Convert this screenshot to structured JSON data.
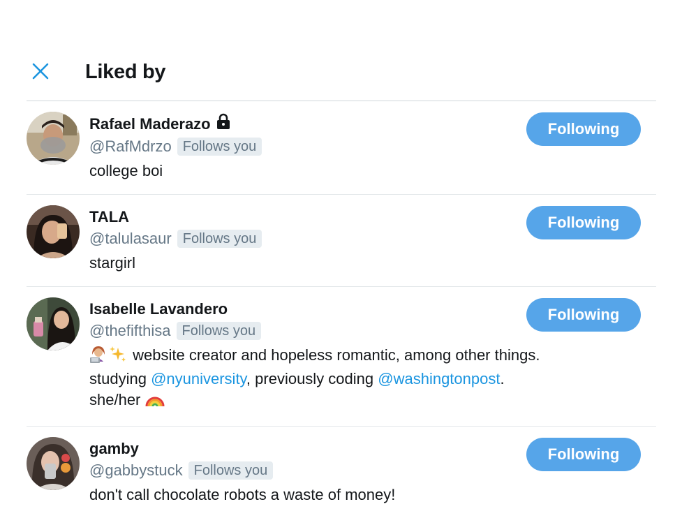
{
  "header": {
    "title": "Liked by",
    "close_icon": "close-icon"
  },
  "colors": {
    "accent": "#1b95e0",
    "button_bg": "#56a5e9",
    "muted": "#657786",
    "badge_bg": "#e6ecf0"
  },
  "users": [
    {
      "name": "Rafael Maderazo",
      "protected": true,
      "handle": "@RafMdrzo",
      "follows_you": "Follows you",
      "bio": "college boi",
      "button": "Following"
    },
    {
      "name": "TALA",
      "handle": "@talulasaur",
      "follows_you": "Follows you",
      "bio": "stargirl",
      "button": "Following"
    },
    {
      "name": "Isabelle Lavandero",
      "handle": "@thefifthisa",
      "follows_you": "Follows you",
      "bio": {
        "emoji_1": "woman-technologist-emoji",
        "emoji_2": "sparkles-emoji",
        "text_1": " website creator and hopeless romantic, among other things. studying ",
        "mention_1": "@nyuniversity",
        "text_2": ", previously coding ",
        "mention_2": "@washingtonpost",
        "text_3": ". she/her ",
        "emoji_3": "rainbow-emoji"
      },
      "button": "Following"
    },
    {
      "name": "gamby",
      "handle": "@gabbystuck",
      "follows_you": "Follows you",
      "bio": "don't call chocolate robots a waste of money!",
      "button": "Following"
    }
  ]
}
